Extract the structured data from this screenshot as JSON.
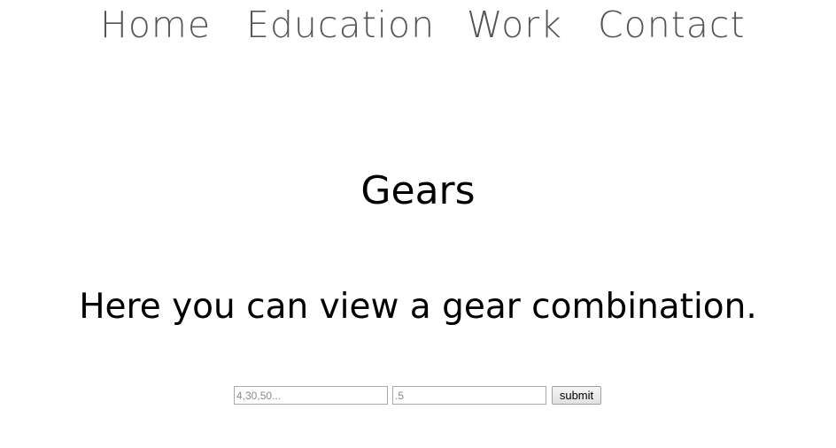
{
  "nav": {
    "items": [
      {
        "label": "Home"
      },
      {
        "label": "Education"
      },
      {
        "label": "Work"
      },
      {
        "label": "Contact"
      }
    ]
  },
  "main": {
    "title": "Gears",
    "subtitle": "Here you can view a gear combination."
  },
  "form": {
    "gears_placeholder": "4,30,50...",
    "ratio_placeholder": ".5",
    "submit_label": "submit"
  }
}
